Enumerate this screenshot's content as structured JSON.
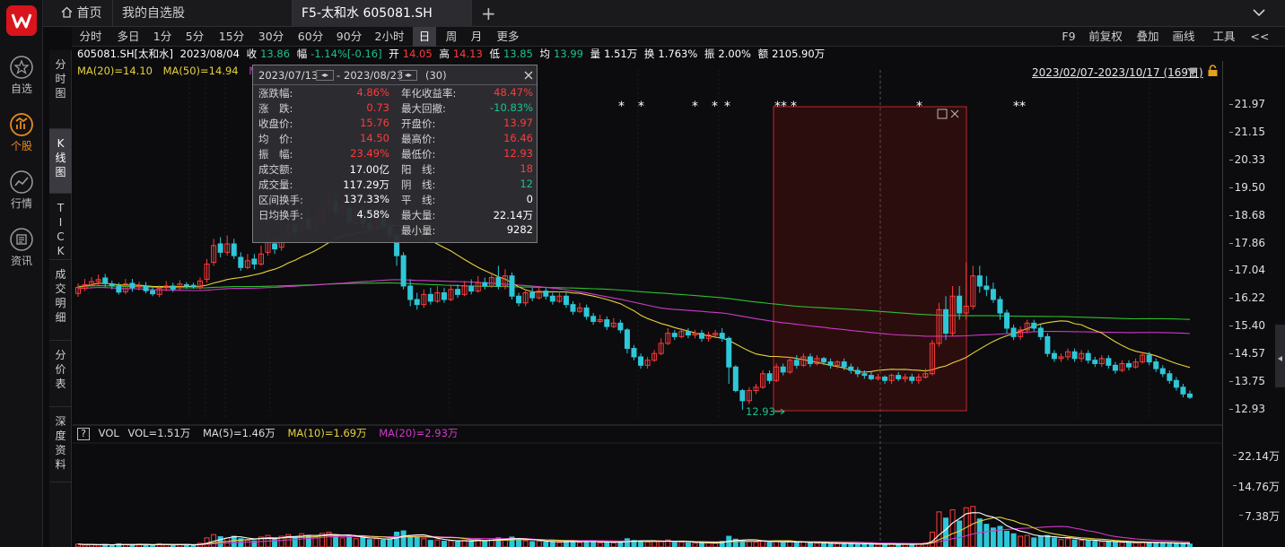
{
  "app": {
    "tabs": [
      {
        "label": "首页",
        "icon": "home-icon"
      },
      {
        "label": "我的自选股"
      },
      {
        "label": "F5-太和水 605081.SH"
      }
    ],
    "add_tab_label": "+"
  },
  "sidebar": {
    "items": [
      {
        "label": "自选",
        "icon": "star-icon"
      },
      {
        "label": "个股",
        "icon": "stock-chart-icon"
      },
      {
        "label": "行情",
        "icon": "trend-icon"
      },
      {
        "label": "资讯",
        "icon": "news-icon"
      }
    ]
  },
  "side_tabs": [
    {
      "label": "分时图"
    },
    {
      "label": "K线图"
    },
    {
      "label": "TICK"
    },
    {
      "label": "成交明细"
    },
    {
      "label": "分价表"
    },
    {
      "label": "深度资料"
    }
  ],
  "periods": [
    "分时",
    "多日",
    "1分",
    "5分",
    "15分",
    "30分",
    "60分",
    "90分",
    "2小时",
    "日",
    "周",
    "月",
    "更多"
  ],
  "right_tools": [
    "F9",
    "前复权",
    "叠加",
    "画线",
    "工具",
    "<<"
  ],
  "info": {
    "code": "605081.SH[太和水]",
    "date": "2023/08/04",
    "close_label": "收",
    "close": "13.86",
    "change_label": "幅",
    "change": "-1.14%[-0.16]",
    "open_label": "开",
    "open": "14.05",
    "high_label": "高",
    "high": "14.13",
    "low_label": "低",
    "low": "13.85",
    "avg_label": "均",
    "avg": "13.99",
    "vol_label": "量",
    "vol": "1.51万",
    "turn_label": "换",
    "turn": "1.763%",
    "amp_label": "振",
    "amp": "2.00%",
    "amt_label": "额",
    "amt": "2105.90万"
  },
  "ma": {
    "ma20": "MA(20)=14.10",
    "ma50": "MA(50)=14.94",
    "ma_cut": "MA"
  },
  "range_label": "2023/02/07-2023/10/17 (169日)",
  "vol_indicator": {
    "help": "?",
    "name": "VOL",
    "vol": "VOL=1.51万",
    "ma5": "MA(5)=1.46万",
    "ma10": "MA(10)=1.69万",
    "ma20": "MA(20)=2.93万"
  },
  "stats": {
    "date_from": "2023/07/13",
    "sep": "-",
    "date_to": "2023/08/23",
    "days": "(30)",
    "left": [
      {
        "label": "涨跌幅:",
        "value": "4.86%",
        "color": "#ff3b3b"
      },
      {
        "label": "涨　跌:",
        "value": "0.73",
        "color": "#ff3b3b"
      },
      {
        "label": "收盘价:",
        "value": "15.76",
        "color": "#ff3b3b"
      },
      {
        "label": "均　价:",
        "value": "14.50",
        "color": "#ff3b3b"
      },
      {
        "label": "振　幅:",
        "value": "23.49%",
        "color": "#ff3b3b"
      },
      {
        "label": "成交额:",
        "value": "17.00亿",
        "color": "#ffffff"
      },
      {
        "label": "成交量:",
        "value": "117.29万",
        "color": "#ffffff"
      },
      {
        "label": "区间换手:",
        "value": "137.33%",
        "color": "#ffffff"
      },
      {
        "label": "日均换手:",
        "value": "4.58%",
        "color": "#ffffff"
      }
    ],
    "right": [
      {
        "label": "年化收益率:",
        "value": "48.47%",
        "color": "#ff3b3b"
      },
      {
        "label": "最大回撤:",
        "value": "-10.83%",
        "color": "#1fc08a"
      },
      {
        "label": "开盘价:",
        "value": "13.97",
        "color": "#ff3b3b"
      },
      {
        "label": "最高价:",
        "value": "16.46",
        "color": "#ff3b3b"
      },
      {
        "label": "最低价:",
        "value": "12.93",
        "color": "#ff3b3b"
      },
      {
        "label": "阳　线:",
        "value": "18",
        "color": "#ff3b3b"
      },
      {
        "label": "阴　线:",
        "value": "12",
        "color": "#1fc08a"
      },
      {
        "label": "平　线:",
        "value": "0",
        "color": "#ffffff"
      },
      {
        "label": "最大量:",
        "value": "22.14万",
        "color": "#ffffff"
      },
      {
        "label": "最小量:",
        "value": "9282",
        "color": "#ffffff"
      }
    ]
  },
  "chart_data": {
    "type": "candlestick",
    "price_axis_ticks": [
      "21.97",
      "21.15",
      "20.33",
      "19.50",
      "18.68",
      "17.86",
      "17.04",
      "16.22",
      "15.40",
      "14.57",
      "13.75",
      "12.93"
    ],
    "volume_axis_ticks": [
      "22.14万",
      "14.76万",
      "7.38万"
    ],
    "min_label": "12.93",
    "ylim": [
      12.93,
      21.97
    ],
    "vol_ylim": [
      0,
      22.14
    ],
    "star_marks": [
      "*",
      "*",
      "*",
      "*",
      "*",
      "**",
      "*",
      "*",
      "**"
    ],
    "colors": {
      "up": "#ff3b3b",
      "down": "#2ec7d8",
      "ma20": "#e6d23a",
      "ma50": "#cf39c9",
      "ma_long": "#2fbf2f",
      "vol_ma5": "#ffffff",
      "vol_ma10": "#e6d23a",
      "vol_ma20": "#cf39c9"
    },
    "candles": [
      [
        16.38,
        16.56,
        16.68,
        16.28,
        0.7
      ],
      [
        16.53,
        16.64,
        16.81,
        16.45,
        0.5
      ],
      [
        16.63,
        16.73,
        16.86,
        16.58,
        0.6
      ],
      [
        16.73,
        16.79,
        16.94,
        16.61,
        0.5
      ],
      [
        16.84,
        16.67,
        16.96,
        16.57,
        0.6
      ],
      [
        16.66,
        16.61,
        16.76,
        16.5,
        0.4
      ],
      [
        16.6,
        16.42,
        16.7,
        16.35,
        0.8
      ],
      [
        16.43,
        16.66,
        16.81,
        16.36,
        0.6
      ],
      [
        16.68,
        16.55,
        16.81,
        16.43,
        0.5
      ],
      [
        16.58,
        16.6,
        16.73,
        16.47,
        0.7
      ],
      [
        16.6,
        16.46,
        16.72,
        16.38,
        0.6
      ],
      [
        16.46,
        16.37,
        16.55,
        16.3,
        0.4
      ],
      [
        16.35,
        16.53,
        16.62,
        16.27,
        0.8
      ],
      [
        16.55,
        16.6,
        16.75,
        16.45,
        0.6
      ],
      [
        16.6,
        16.51,
        16.7,
        16.42,
        0.5
      ],
      [
        16.55,
        16.66,
        16.77,
        16.48,
        0.6
      ],
      [
        16.64,
        16.6,
        16.72,
        16.52,
        0.5
      ],
      [
        16.62,
        16.58,
        16.7,
        16.52,
        0.4
      ],
      [
        16.55,
        16.75,
        16.85,
        16.5,
        0.9
      ],
      [
        16.8,
        17.25,
        17.4,
        16.7,
        2.2
      ],
      [
        17.3,
        17.8,
        18.0,
        17.2,
        3.0
      ],
      [
        17.85,
        17.6,
        18.05,
        17.45,
        2.5
      ],
      [
        17.6,
        17.85,
        18.1,
        17.5,
        2.2
      ],
      [
        17.85,
        17.5,
        18.0,
        17.4,
        2.6
      ],
      [
        17.45,
        17.15,
        17.6,
        17.05,
        2.0
      ],
      [
        17.15,
        17.35,
        17.55,
        17.1,
        1.6
      ],
      [
        17.4,
        17.25,
        17.55,
        17.1,
        1.5
      ],
      [
        17.25,
        17.55,
        17.8,
        17.2,
        2.4
      ],
      [
        17.6,
        17.9,
        18.2,
        17.5,
        2.8
      ],
      [
        17.85,
        17.7,
        18.05,
        17.55,
        1.8
      ],
      [
        17.75,
        18.1,
        18.3,
        17.65,
        2.6
      ],
      [
        18.1,
        18.4,
        18.6,
        17.95,
        3.0
      ],
      [
        18.4,
        18.2,
        18.7,
        18.1,
        2.5
      ],
      [
        18.25,
        18.6,
        18.8,
        18.15,
        3.2
      ],
      [
        18.6,
        18.3,
        18.85,
        18.2,
        2.8
      ],
      [
        18.3,
        18.55,
        18.75,
        18.2,
        2.4
      ],
      [
        18.5,
        18.9,
        19.2,
        18.4,
        3.3
      ],
      [
        18.9,
        19.1,
        19.4,
        18.8,
        3.6
      ],
      [
        19.1,
        18.8,
        19.3,
        18.6,
        2.9
      ],
      [
        18.8,
        18.95,
        19.2,
        18.7,
        2.2
      ],
      [
        18.9,
        18.5,
        19.0,
        18.3,
        2.7
      ],
      [
        18.45,
        18.7,
        18.9,
        18.35,
        2.0
      ],
      [
        18.7,
        18.45,
        18.95,
        18.3,
        2.3
      ],
      [
        18.45,
        18.3,
        18.6,
        18.15,
        1.8
      ],
      [
        18.3,
        18.6,
        18.8,
        18.2,
        2.0
      ],
      [
        18.6,
        18.4,
        18.75,
        18.3,
        1.7
      ],
      [
        18.35,
        18.1,
        18.5,
        18.0,
        1.9
      ],
      [
        18.1,
        17.5,
        18.2,
        17.2,
        3.6
      ],
      [
        17.5,
        16.6,
        17.6,
        16.5,
        3.9
      ],
      [
        16.6,
        16.2,
        16.8,
        16.0,
        2.8
      ],
      [
        16.2,
        16.05,
        16.4,
        15.9,
        2.5
      ],
      [
        16.05,
        16.35,
        16.5,
        15.95,
        2.0
      ],
      [
        16.35,
        16.15,
        16.55,
        16.05,
        1.6
      ],
      [
        16.15,
        16.4,
        16.6,
        16.1,
        1.7
      ],
      [
        16.4,
        16.2,
        16.55,
        16.1,
        1.4
      ],
      [
        16.2,
        16.5,
        16.6,
        16.15,
        1.5
      ],
      [
        16.5,
        16.35,
        16.65,
        16.25,
        1.3
      ],
      [
        16.35,
        16.6,
        16.75,
        16.3,
        1.6
      ],
      [
        16.6,
        16.45,
        16.8,
        16.35,
        1.5
      ],
      [
        16.45,
        16.7,
        16.9,
        16.4,
        1.8
      ],
      [
        16.7,
        16.6,
        16.85,
        16.5,
        1.4
      ],
      [
        16.6,
        16.85,
        17.0,
        16.55,
        2.0
      ],
      [
        16.85,
        16.6,
        17.2,
        16.5,
        2.2
      ],
      [
        16.6,
        16.9,
        17.1,
        16.5,
        1.9
      ],
      [
        16.9,
        16.3,
        17.0,
        16.2,
        2.4
      ],
      [
        16.3,
        16.1,
        16.4,
        16.0,
        1.8
      ],
      [
        16.1,
        16.4,
        16.5,
        16.0,
        1.5
      ],
      [
        16.4,
        16.25,
        16.55,
        16.15,
        1.3
      ],
      [
        16.25,
        16.45,
        16.6,
        16.2,
        1.4
      ],
      [
        16.45,
        16.3,
        16.55,
        16.2,
        1.2
      ],
      [
        16.3,
        16.15,
        16.4,
        16.05,
        1.3
      ],
      [
        16.15,
        16.3,
        16.45,
        16.1,
        1.1
      ],
      [
        16.3,
        16.05,
        16.4,
        15.95,
        1.4
      ],
      [
        16.05,
        15.85,
        16.15,
        15.75,
        1.5
      ],
      [
        15.85,
        15.95,
        16.1,
        15.8,
        1.1
      ],
      [
        15.95,
        15.7,
        16.05,
        15.6,
        1.4
      ],
      [
        15.7,
        15.55,
        15.8,
        15.45,
        1.3
      ],
      [
        15.55,
        15.6,
        15.75,
        15.5,
        1.0
      ],
      [
        15.6,
        15.4,
        15.7,
        15.3,
        1.2
      ],
      [
        15.4,
        15.5,
        15.65,
        15.35,
        1.0
      ],
      [
        15.5,
        15.3,
        15.6,
        15.2,
        1.3
      ],
      [
        15.3,
        14.75,
        15.35,
        14.6,
        2.0
      ],
      [
        14.75,
        14.5,
        14.85,
        14.4,
        1.6
      ],
      [
        14.5,
        14.25,
        14.6,
        14.15,
        1.5
      ],
      [
        14.25,
        14.4,
        14.5,
        14.15,
        1.2
      ],
      [
        14.4,
        14.6,
        14.7,
        14.35,
        1.3
      ],
      [
        14.6,
        14.9,
        15.05,
        14.55,
        1.5
      ],
      [
        14.9,
        15.2,
        15.35,
        14.85,
        1.7
      ],
      [
        15.2,
        15.1,
        15.3,
        15.0,
        1.1
      ],
      [
        15.1,
        15.25,
        15.35,
        15.05,
        1.2
      ],
      [
        15.25,
        15.15,
        15.35,
        15.05,
        1.0
      ],
      [
        15.15,
        15.2,
        15.3,
        15.05,
        0.9
      ],
      [
        15.2,
        15.05,
        15.3,
        14.95,
        1.1
      ],
      [
        15.05,
        15.15,
        15.25,
        14.95,
        1.0
      ],
      [
        15.15,
        15.2,
        15.3,
        15.05,
        0.9
      ],
      [
        15.2,
        15.05,
        15.35,
        14.95,
        1.4
      ],
      [
        15.05,
        14.2,
        15.1,
        13.7,
        2.6
      ],
      [
        14.2,
        13.5,
        14.25,
        13.45,
        1.9
      ],
      [
        13.5,
        13.2,
        13.55,
        12.93,
        1.6
      ],
      [
        13.2,
        13.5,
        13.6,
        13.1,
        1.3
      ],
      [
        13.5,
        13.6,
        13.7,
        13.4,
        1.2
      ],
      [
        13.6,
        14.0,
        14.1,
        13.55,
        1.5
      ],
      [
        14.0,
        13.8,
        14.1,
        13.7,
        1.2
      ],
      [
        13.8,
        14.2,
        14.3,
        13.75,
        1.4
      ],
      [
        14.2,
        14.05,
        14.3,
        13.95,
        1.0
      ],
      [
        14.05,
        14.4,
        14.5,
        14.0,
        1.3
      ],
      [
        14.4,
        14.25,
        14.55,
        14.15,
        1.1
      ],
      [
        14.25,
        14.5,
        14.6,
        14.2,
        1.2
      ],
      [
        14.5,
        14.3,
        14.6,
        14.2,
        1.0
      ],
      [
        14.3,
        14.45,
        14.55,
        14.25,
        0.9
      ],
      [
        14.45,
        14.35,
        14.5,
        14.25,
        0.9
      ],
      [
        14.35,
        14.25,
        14.45,
        14.15,
        0.8
      ],
      [
        14.25,
        14.35,
        14.4,
        14.15,
        0.8
      ],
      [
        14.35,
        14.2,
        14.45,
        14.1,
        0.9
      ],
      [
        14.2,
        14.1,
        14.3,
        14.0,
        0.8
      ],
      [
        14.1,
        14.0,
        14.2,
        13.9,
        0.8
      ],
      [
        14.0,
        13.95,
        14.1,
        13.85,
        0.7
      ],
      [
        13.95,
        13.85,
        14.05,
        13.8,
        0.7
      ],
      [
        13.85,
        13.9,
        14.0,
        13.8,
        0.6
      ],
      [
        13.9,
        13.8,
        13.95,
        13.7,
        0.7
      ],
      [
        13.8,
        13.95,
        14.0,
        13.7,
        0.7
      ],
      [
        13.95,
        13.85,
        14.05,
        13.78,
        0.7
      ],
      [
        13.85,
        13.9,
        14.0,
        13.75,
        0.6
      ],
      [
        13.9,
        13.8,
        14.0,
        13.7,
        0.7
      ],
      [
        13.8,
        13.9,
        14.0,
        13.7,
        0.8
      ],
      [
        13.9,
        14.0,
        14.15,
        13.85,
        1.0
      ],
      [
        14.0,
        14.9,
        15.0,
        13.95,
        3.6
      ],
      [
        14.9,
        15.9,
        16.1,
        14.8,
        8.5
      ],
      [
        15.9,
        15.2,
        16.3,
        15.0,
        7.0
      ],
      [
        15.2,
        16.3,
        16.6,
        15.1,
        9.0
      ],
      [
        16.3,
        15.8,
        16.6,
        15.6,
        6.3
      ],
      [
        15.8,
        16.0,
        17.3,
        15.6,
        9.5
      ],
      [
        16.0,
        16.9,
        17.2,
        15.9,
        9.8
      ],
      [
        16.9,
        16.6,
        17.2,
        16.4,
        6.8
      ],
      [
        16.6,
        16.5,
        16.9,
        16.3,
        5.5
      ],
      [
        16.5,
        16.2,
        16.7,
        16.1,
        4.6
      ],
      [
        16.2,
        15.8,
        16.3,
        15.6,
        5.0
      ],
      [
        15.8,
        15.35,
        15.9,
        15.2,
        3.8
      ],
      [
        15.35,
        15.1,
        15.45,
        15.0,
        3.2
      ],
      [
        15.1,
        15.3,
        15.4,
        15.0,
        2.6
      ],
      [
        15.3,
        15.5,
        15.6,
        15.2,
        2.8
      ],
      [
        15.5,
        15.35,
        15.6,
        15.25,
        2.2
      ],
      [
        15.35,
        15.1,
        15.45,
        15.0,
        2.5
      ],
      [
        15.1,
        14.6,
        15.2,
        14.5,
        2.8
      ],
      [
        14.6,
        14.45,
        14.7,
        14.35,
        2.2
      ],
      [
        14.45,
        14.5,
        14.6,
        14.35,
        1.8
      ],
      [
        14.5,
        14.65,
        14.75,
        14.4,
        2.0
      ],
      [
        14.65,
        14.45,
        14.75,
        14.35,
        1.7
      ],
      [
        14.45,
        14.6,
        14.7,
        14.35,
        1.6
      ],
      [
        14.6,
        14.4,
        14.7,
        14.3,
        1.5
      ],
      [
        14.4,
        14.3,
        14.5,
        14.2,
        1.4
      ],
      [
        14.3,
        14.45,
        14.55,
        14.2,
        1.3
      ],
      [
        14.45,
        14.25,
        14.55,
        14.15,
        1.2
      ],
      [
        14.25,
        14.1,
        14.35,
        14.0,
        1.2
      ],
      [
        14.1,
        14.3,
        14.4,
        14.05,
        1.1
      ],
      [
        14.3,
        14.2,
        14.4,
        14.1,
        1.0
      ],
      [
        14.2,
        14.35,
        14.45,
        14.15,
        1.0
      ],
      [
        14.35,
        14.55,
        14.65,
        14.3,
        1.2
      ],
      [
        14.55,
        14.35,
        14.65,
        14.25,
        1.1
      ],
      [
        14.35,
        14.15,
        14.45,
        14.05,
        1.0
      ],
      [
        14.15,
        14.0,
        14.25,
        13.9,
        0.9
      ],
      [
        14.0,
        13.8,
        14.1,
        13.7,
        0.9
      ],
      [
        13.8,
        13.6,
        13.9,
        13.5,
        0.8
      ],
      [
        13.6,
        13.4,
        13.7,
        13.3,
        0.8
      ],
      [
        13.4,
        13.3,
        13.5,
        13.25,
        0.7
      ]
    ]
  }
}
